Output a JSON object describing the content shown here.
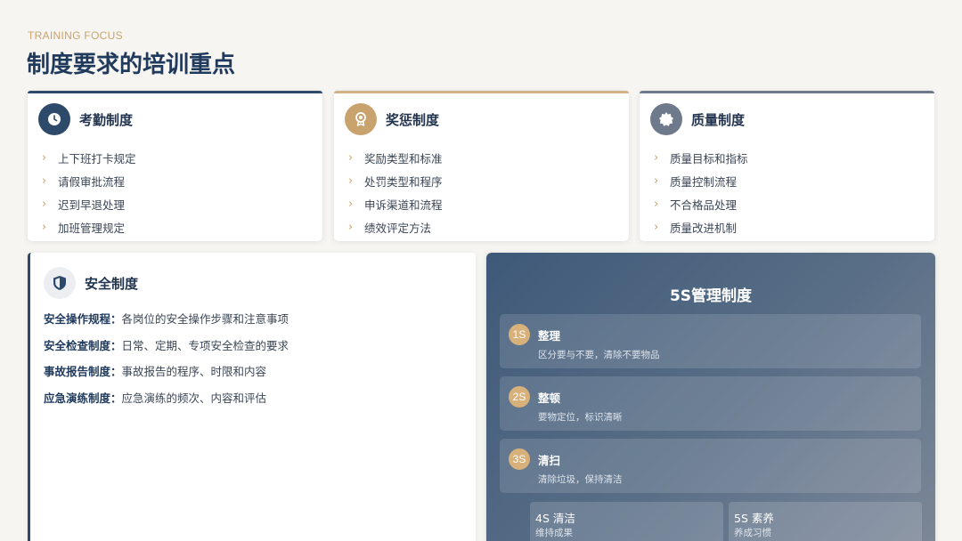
{
  "header": {
    "eyebrow": "TRAINING FOCUS",
    "title": "制度要求的培训重点"
  },
  "colors": {
    "navy": "#2d4a6b",
    "gold": "#c9a36e",
    "slate": "#6e7a8c",
    "background": "#f6f5f1"
  },
  "cards": [
    {
      "title": "考勤制度",
      "icon": "clock-icon",
      "items": [
        "上下班打卡规定",
        "请假审批流程",
        "迟到早退处理",
        "加班管理规定"
      ]
    },
    {
      "title": "奖惩制度",
      "icon": "award-icon",
      "items": [
        "奖励类型和标准",
        "处罚类型和程序",
        "申诉渠道和流程",
        "绩效评定方法"
      ]
    },
    {
      "title": "质量制度",
      "icon": "badge-icon",
      "items": [
        "质量目标和指标",
        "质量控制流程",
        "不合格品处理",
        "质量改进机制"
      ]
    }
  ],
  "safety": {
    "title": "安全制度",
    "icon": "shield-icon",
    "rows": [
      {
        "label": "安全操作规程：",
        "text": "各岗位的安全操作步骤和注意事项"
      },
      {
        "label": "安全检查制度：",
        "text": "日常、定期、专项安全检查的要求"
      },
      {
        "label": "事故报告制度：",
        "text": "事故报告的程序、时限和内容"
      },
      {
        "label": "应急演练制度：",
        "text": "应急演练的频次、内容和评估"
      }
    ]
  },
  "fives": {
    "title": "5S管理制度",
    "steps": [
      {
        "badge": "1S",
        "name": "整理",
        "desc": "区分要与不要，清除不要物品"
      },
      {
        "badge": "2S",
        "name": "整顿",
        "desc": "要物定位，标识清晰"
      },
      {
        "badge": "3S",
        "name": "清扫",
        "desc": "清除垃圾，保持清洁"
      }
    ],
    "mini": [
      {
        "name": "4S 清洁",
        "desc": "维持成果"
      },
      {
        "name": "5S 素养",
        "desc": "养成习惯"
      }
    ]
  }
}
